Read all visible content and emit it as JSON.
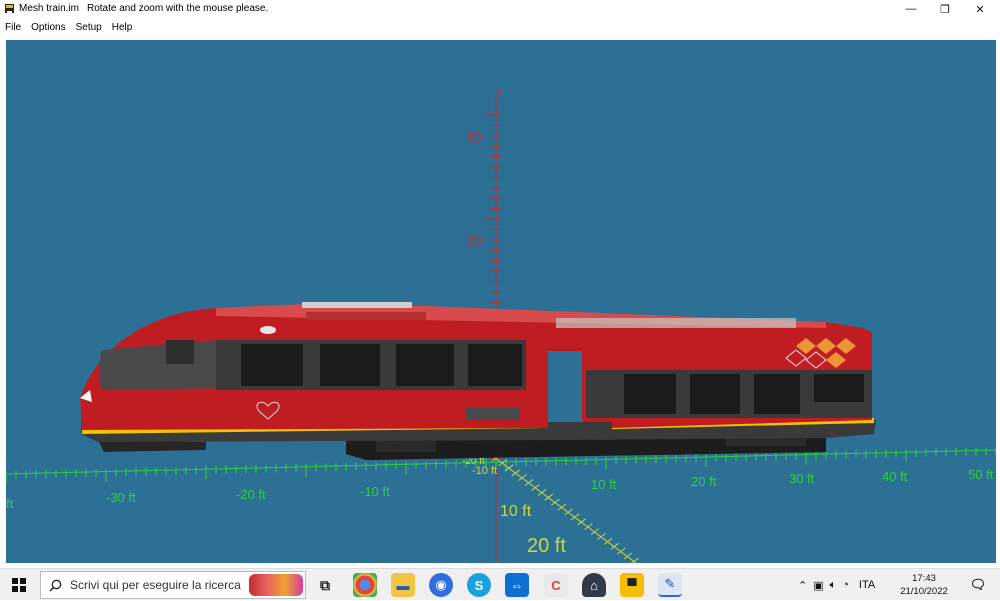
{
  "window": {
    "title": "Mesh train.im",
    "subtitle": "Rotate and zoom with the mouse please.",
    "minimize_glyph": "—",
    "maximize_glyph": "❐",
    "close_glyph": "✕"
  },
  "menu": [
    "File",
    "Options",
    "Setup",
    "Help"
  ],
  "scene": {
    "background": "#2c7096",
    "z_axis_label": "Z",
    "z_ticks": [
      "30",
      "20"
    ],
    "x_ticks": [
      "-30 ft",
      "-20 ft",
      "-10 ft",
      "10 ft",
      "20 ft",
      "30 ft",
      "40 ft",
      "50 ft"
    ],
    "x_tick_left_partial": "ft",
    "y_ticks": [
      "-20 ft",
      "-10 ft",
      "10 ft",
      "20 ft"
    ],
    "train_colors": {
      "body": "#c01d22",
      "skirt": "#3a3a3a",
      "stripe": "#f1c400"
    }
  },
  "taskbar": {
    "search_placeholder": "Scrivi qui per eseguire la ricerca",
    "language": "ITA",
    "time": "17:43",
    "date": "21/10/2022"
  }
}
